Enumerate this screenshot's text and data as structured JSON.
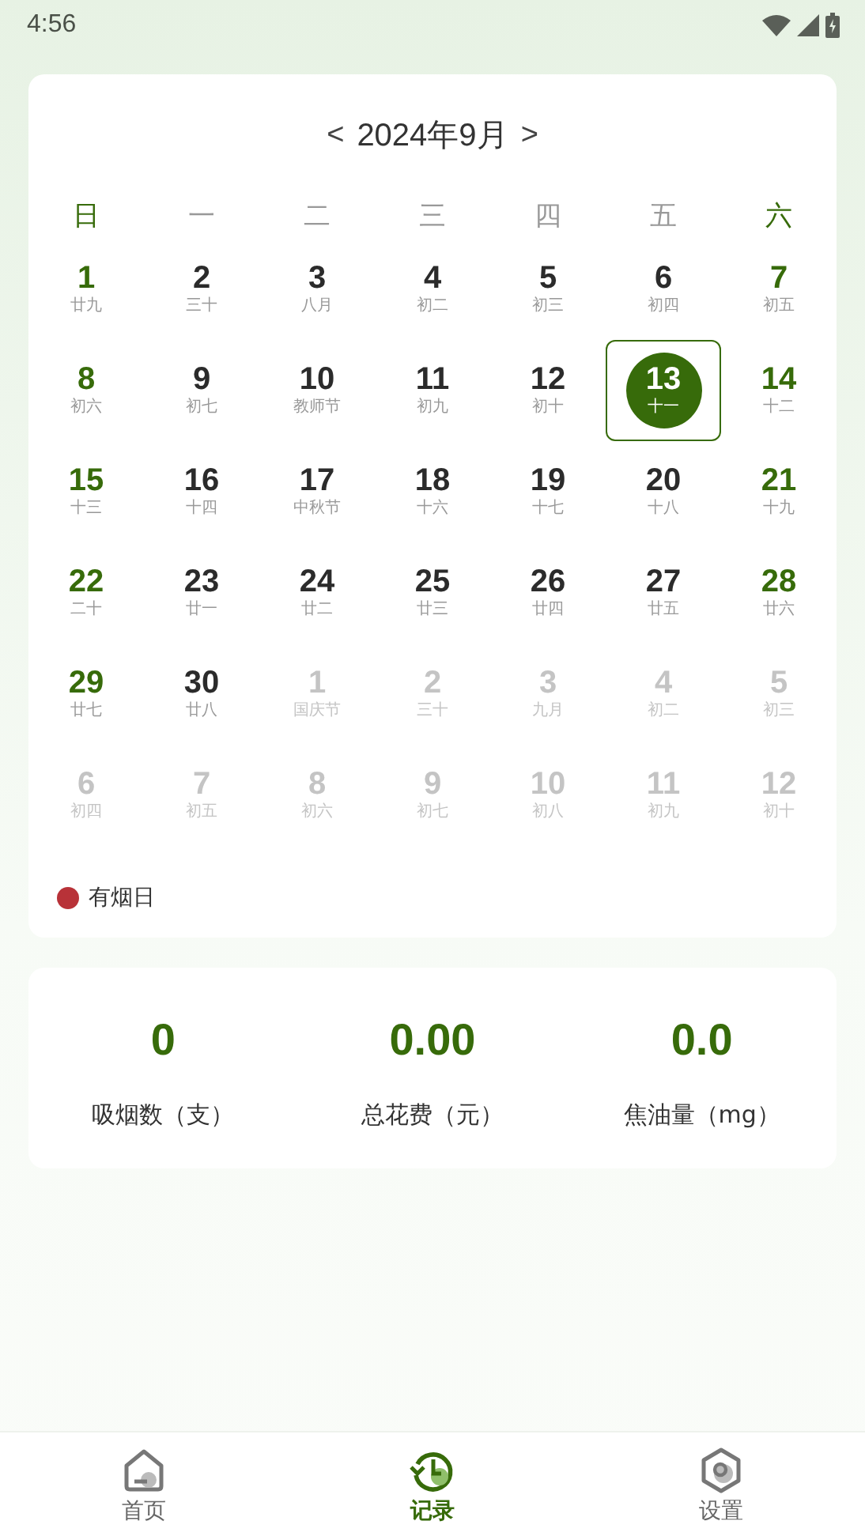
{
  "status_bar": {
    "time": "4:56"
  },
  "calendar": {
    "prev": "<",
    "title": "2024年9月",
    "next": ">",
    "weekdays": [
      {
        "label": "日",
        "weekend": true
      },
      {
        "label": "一",
        "weekend": false
      },
      {
        "label": "二",
        "weekend": false
      },
      {
        "label": "三",
        "weekend": false
      },
      {
        "label": "四",
        "weekend": false
      },
      {
        "label": "五",
        "weekend": false
      },
      {
        "label": "六",
        "weekend": true
      }
    ],
    "weeks": [
      [
        {
          "day": "1",
          "lunar": "廿九",
          "in_month": true,
          "weekend": true,
          "selected": false
        },
        {
          "day": "2",
          "lunar": "三十",
          "in_month": true,
          "weekend": false,
          "selected": false
        },
        {
          "day": "3",
          "lunar": "八月",
          "in_month": true,
          "weekend": false,
          "selected": false
        },
        {
          "day": "4",
          "lunar": "初二",
          "in_month": true,
          "weekend": false,
          "selected": false
        },
        {
          "day": "5",
          "lunar": "初三",
          "in_month": true,
          "weekend": false,
          "selected": false
        },
        {
          "day": "6",
          "lunar": "初四",
          "in_month": true,
          "weekend": false,
          "selected": false
        },
        {
          "day": "7",
          "lunar": "初五",
          "in_month": true,
          "weekend": true,
          "selected": false
        }
      ],
      [
        {
          "day": "8",
          "lunar": "初六",
          "in_month": true,
          "weekend": true,
          "selected": false
        },
        {
          "day": "9",
          "lunar": "初七",
          "in_month": true,
          "weekend": false,
          "selected": false
        },
        {
          "day": "10",
          "lunar": "教师节",
          "in_month": true,
          "weekend": false,
          "selected": false
        },
        {
          "day": "11",
          "lunar": "初九",
          "in_month": true,
          "weekend": false,
          "selected": false
        },
        {
          "day": "12",
          "lunar": "初十",
          "in_month": true,
          "weekend": false,
          "selected": false
        },
        {
          "day": "13",
          "lunar": "十一",
          "selected": true
        },
        {
          "day": "14",
          "lunar": "十二",
          "in_month": true,
          "weekend": true,
          "selected": false
        }
      ],
      [
        {
          "day": "15",
          "lunar": "十三",
          "in_month": true,
          "weekend": true,
          "selected": false
        },
        {
          "day": "16",
          "lunar": "十四",
          "in_month": true,
          "weekend": false,
          "selected": false
        },
        {
          "day": "17",
          "lunar": "中秋节",
          "in_month": true,
          "weekend": false,
          "selected": false
        },
        {
          "day": "18",
          "lunar": "十六",
          "in_month": true,
          "weekend": false,
          "selected": false
        },
        {
          "day": "19",
          "lunar": "十七",
          "in_month": true,
          "weekend": false,
          "selected": false
        },
        {
          "day": "20",
          "lunar": "十八",
          "in_month": true,
          "weekend": false,
          "selected": false
        },
        {
          "day": "21",
          "lunar": "十九",
          "in_month": true,
          "weekend": true,
          "selected": false
        }
      ],
      [
        {
          "day": "22",
          "lunar": "二十",
          "in_month": true,
          "weekend": true,
          "selected": false
        },
        {
          "day": "23",
          "lunar": "廿一",
          "in_month": true,
          "weekend": false,
          "selected": false
        },
        {
          "day": "24",
          "lunar": "廿二",
          "in_month": true,
          "weekend": false,
          "selected": false
        },
        {
          "day": "25",
          "lunar": "廿三",
          "in_month": true,
          "weekend": false,
          "selected": false
        },
        {
          "day": "26",
          "lunar": "廿四",
          "in_month": true,
          "weekend": false,
          "selected": false
        },
        {
          "day": "27",
          "lunar": "廿五",
          "in_month": true,
          "weekend": false,
          "selected": false
        },
        {
          "day": "28",
          "lunar": "廿六",
          "in_month": true,
          "weekend": true,
          "selected": false
        }
      ],
      [
        {
          "day": "29",
          "lunar": "廿七",
          "in_month": true,
          "weekend": true,
          "selected": false
        },
        {
          "day": "30",
          "lunar": "廿八",
          "in_month": true,
          "weekend": false,
          "selected": false
        },
        {
          "day": "1",
          "lunar": "国庆节",
          "in_month": false,
          "selected": false
        },
        {
          "day": "2",
          "lunar": "三十",
          "in_month": false,
          "selected": false
        },
        {
          "day": "3",
          "lunar": "九月",
          "in_month": false,
          "selected": false
        },
        {
          "day": "4",
          "lunar": "初二",
          "in_month": false,
          "selected": false
        },
        {
          "day": "5",
          "lunar": "初三",
          "in_month": false,
          "selected": false
        }
      ],
      [
        {
          "day": "6",
          "lunar": "初四",
          "in_month": false,
          "selected": false
        },
        {
          "day": "7",
          "lunar": "初五",
          "in_month": false,
          "selected": false
        },
        {
          "day": "8",
          "lunar": "初六",
          "in_month": false,
          "selected": false
        },
        {
          "day": "9",
          "lunar": "初七",
          "in_month": false,
          "selected": false
        },
        {
          "day": "10",
          "lunar": "初八",
          "in_month": false,
          "selected": false
        },
        {
          "day": "11",
          "lunar": "初九",
          "in_month": false,
          "selected": false
        },
        {
          "day": "12",
          "lunar": "初十",
          "in_month": false,
          "selected": false
        }
      ]
    ],
    "legend": {
      "label": "有烟日",
      "color": "#b83238"
    }
  },
  "stats": [
    {
      "value": "0",
      "label": "吸烟数（支）"
    },
    {
      "value": "0.00",
      "label": "总花费（元）"
    },
    {
      "value": "0.0",
      "label": "焦油量（mg）"
    }
  ],
  "nav": [
    {
      "label": "首页",
      "kind": "home",
      "selected": false
    },
    {
      "label": "记录",
      "kind": "record",
      "selected": true
    },
    {
      "label": "设置",
      "kind": "settings",
      "selected": false
    }
  ]
}
